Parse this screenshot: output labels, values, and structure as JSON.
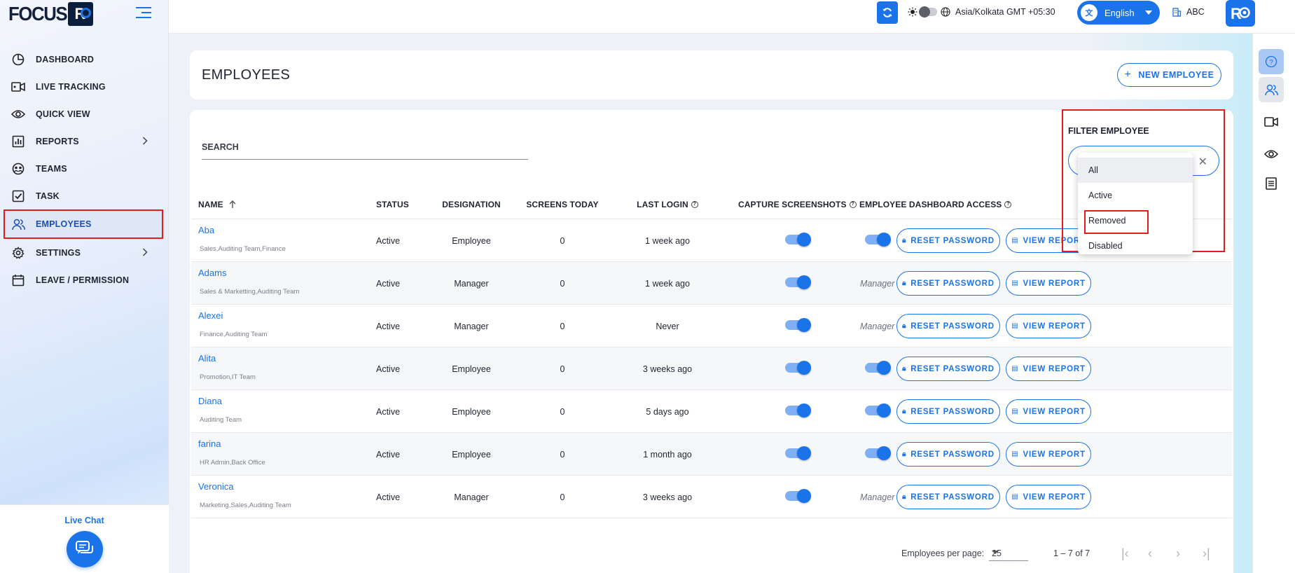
{
  "brand": {
    "logo_text": "FOCUS",
    "logo_box_letter": "R"
  },
  "sidebar": {
    "items": [
      {
        "label": "DASHBOARD",
        "icon": "pie-chart-icon"
      },
      {
        "label": "LIVE TRACKING",
        "icon": "video-icon"
      },
      {
        "label": "QUICK VIEW",
        "icon": "eye-icon"
      },
      {
        "label": "REPORTS",
        "icon": "report-icon",
        "chevron": true
      },
      {
        "label": "TEAMS",
        "icon": "teams-icon"
      },
      {
        "label": "TASK",
        "icon": "checkbox-icon"
      },
      {
        "label": "EMPLOYEES",
        "icon": "users-icon",
        "active": true
      },
      {
        "label": "SETTINGS",
        "icon": "gear-icon",
        "chevron": true
      },
      {
        "label": "LEAVE / PERMISSION",
        "icon": "calendar-icon"
      }
    ],
    "live_chat_label": "Live Chat"
  },
  "topbar": {
    "timezone": "Asia/Kolkata GMT +05:30",
    "language": "English",
    "company": "ABC"
  },
  "page": {
    "title": "EMPLOYEES",
    "new_button": "NEW EMPLOYEE",
    "search_label": "SEARCH",
    "filter_label": "FILTER EMPLOYEE",
    "filter_options": [
      "All",
      "Active",
      "Removed",
      "Disabled"
    ],
    "filter_highlight": "All",
    "filter_marked": "Removed"
  },
  "table": {
    "headers": {
      "name": "NAME",
      "status": "STATUS",
      "designation": "DESIGNATION",
      "screens": "SCREENS TODAY",
      "last_login": "LAST LOGIN",
      "capture": "CAPTURE SCREENSHOTS",
      "dashboard": "EMPLOYEE DASHBOARD ACCESS"
    },
    "reset_label": "RESET PASSWORD",
    "view_label": "VIEW REPORT",
    "rows": [
      {
        "name": "Aba",
        "teams": "Sales,Auditing Team,Finance",
        "status": "Active",
        "designation": "Employee",
        "screens": "0",
        "last_login": "1 week ago",
        "dashboard": "toggle"
      },
      {
        "name": "Adams",
        "teams": "Sales & Marketting,Auditing Team",
        "status": "Active",
        "designation": "Manager",
        "screens": "0",
        "last_login": "1 week ago",
        "dashboard": "Manager"
      },
      {
        "name": "Alexei",
        "teams": "Finance,Auditing Team",
        "status": "Active",
        "designation": "Manager",
        "screens": "0",
        "last_login": "Never",
        "dashboard": "Manager"
      },
      {
        "name": "Alita",
        "teams": "Promotion,IT Team",
        "status": "Active",
        "designation": "Employee",
        "screens": "0",
        "last_login": "3 weeks ago",
        "dashboard": "toggle"
      },
      {
        "name": "Diana",
        "teams": "Auditing Team",
        "status": "Active",
        "designation": "Employee",
        "screens": "0",
        "last_login": "5 days ago",
        "dashboard": "toggle"
      },
      {
        "name": "farina",
        "teams": "HR Admin,Back Office",
        "status": "Active",
        "designation": "Employee",
        "screens": "0",
        "last_login": "1 month ago",
        "dashboard": "toggle"
      },
      {
        "name": "Veronica",
        "teams": "Marketing,Sales,Auditing Team",
        "status": "Active",
        "designation": "Manager",
        "screens": "0",
        "last_login": "3 weeks ago",
        "dashboard": "Manager"
      }
    ]
  },
  "pagination": {
    "per_page_label": "Employees per page:",
    "per_page": "25",
    "range": "1 – 7 of 7"
  },
  "colors": {
    "accent": "#1a73e8",
    "highlight_border": "#e21d1d"
  }
}
